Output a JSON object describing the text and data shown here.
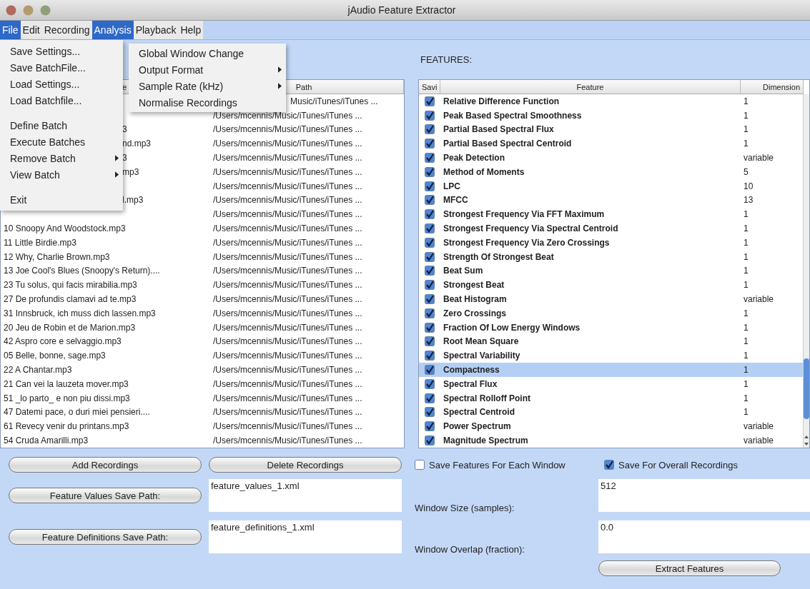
{
  "window": {
    "title": "jAudio Feature Extractor"
  },
  "menu_bar": [
    {
      "label": "File",
      "selected": true
    },
    {
      "label": "Edit",
      "selected": false
    },
    {
      "label": "Recording",
      "selected": false
    },
    {
      "label": "Analysis",
      "selected": true
    },
    {
      "label": "Playback",
      "selected": false
    },
    {
      "label": "Help",
      "selected": false
    }
  ],
  "file_menu": [
    {
      "kind": "item",
      "label": "Save Settings..."
    },
    {
      "kind": "item",
      "label": "Save BatchFile..."
    },
    {
      "kind": "item",
      "label": "Load Settings..."
    },
    {
      "kind": "item",
      "label": "Load Batchfile..."
    },
    {
      "kind": "separator"
    },
    {
      "kind": "item",
      "label": "Define Batch"
    },
    {
      "kind": "item",
      "label": "Execute Batches"
    },
    {
      "kind": "submenu",
      "label": "Remove Batch"
    },
    {
      "kind": "submenu",
      "label": "View Batch"
    },
    {
      "kind": "separator"
    },
    {
      "kind": "item",
      "label": "Exit"
    }
  ],
  "analysis_menu": [
    {
      "kind": "item",
      "label": "Global Window Change"
    },
    {
      "kind": "submenu",
      "label": "Output Format"
    },
    {
      "kind": "submenu",
      "label": "Sample Rate (kHz)"
    },
    {
      "kind": "item",
      "label": "Normalise Recordings"
    }
  ],
  "recordings_table": {
    "columns": [
      {
        "label": "e",
        "kind": "clipped"
      },
      {
        "label": "Path",
        "kind": "full"
      }
    ],
    "rows": [
      {
        "kind": "clipped",
        "path": "Music/iTunes/iTunes ..."
      },
      {
        "kind": "clipped",
        "path": "/Users/mcennis/Music/iTunes/iTunes ..."
      },
      {
        "kind": "clipped",
        "name": "3",
        "path": "/Users/mcennis/Music/iTunes/iTunes ..."
      },
      {
        "kind": "clipped",
        "name": "nd.mp3",
        "path": "/Users/mcennis/Music/iTunes/iTunes ..."
      },
      {
        "kind": "clipped",
        "name": "3",
        "path": "/Users/mcennis/Music/iTunes/iTunes ..."
      },
      {
        "kind": "clipped",
        "name": "mp3",
        "path": "/Users/mcennis/Music/iTunes/iTunes ..."
      },
      {
        "kind": "clipped",
        "path": "/Users/mcennis/Music/iTunes/iTunes ..."
      },
      {
        "kind": "clipped",
        "name": "l.mp3",
        "path": "/Users/mcennis/Music/iTunes/iTunes ..."
      },
      {
        "kind": "clipped",
        "path": "/Users/mcennis/Music/iTunes/iTunes ..."
      },
      {
        "kind": "full",
        "name": "10 Snoopy And Woodstock.mp3",
        "path": "/Users/mcennis/Music/iTunes/iTunes ..."
      },
      {
        "kind": "full",
        "name": "11 Little Birdie.mp3",
        "path": "/Users/mcennis/Music/iTunes/iTunes ..."
      },
      {
        "kind": "full",
        "name": "12 Why, Charlie Brown.mp3",
        "path": "/Users/mcennis/Music/iTunes/iTunes ..."
      },
      {
        "kind": "full",
        "name": "13 Joe Cool's Blues (Snoopy's Return)....",
        "path": "/Users/mcennis/Music/iTunes/iTunes ..."
      },
      {
        "kind": "full",
        "name": "23 Tu solus, qui facis mirabilia.mp3",
        "path": "/Users/mcennis/Music/iTunes/iTunes ..."
      },
      {
        "kind": "full",
        "name": "27 De profundis clamavi ad te.mp3",
        "path": "/Users/mcennis/Music/iTunes/iTunes ..."
      },
      {
        "kind": "full",
        "name": "31 Innsbruck, ich muss dich lassen.mp3",
        "path": "/Users/mcennis/Music/iTunes/iTunes ..."
      },
      {
        "kind": "full",
        "name": "20 Jeu de Robin et de Marion.mp3",
        "path": "/Users/mcennis/Music/iTunes/iTunes ..."
      },
      {
        "kind": "full",
        "name": "42 Aspro core e selvaggio.mp3",
        "path": "/Users/mcennis/Music/iTunes/iTunes ..."
      },
      {
        "kind": "full",
        "name": "05 Belle, bonne, sage.mp3",
        "path": "/Users/mcennis/Music/iTunes/iTunes ..."
      },
      {
        "kind": "full",
        "name": "22 A Chantar.mp3",
        "path": "/Users/mcennis/Music/iTunes/iTunes ..."
      },
      {
        "kind": "full",
        "name": "21 Can vei la lauzeta mover.mp3",
        "path": "/Users/mcennis/Music/iTunes/iTunes ..."
      },
      {
        "kind": "full",
        "name": "51 _lo parto_ e non piu dissi.mp3",
        "path": "/Users/mcennis/Music/iTunes/iTunes ..."
      },
      {
        "kind": "full",
        "name": "47 Datemi pace, o duri miei pensieri....",
        "path": "/Users/mcennis/Music/iTunes/iTunes ..."
      },
      {
        "kind": "full",
        "name": "61 Revecy venir du printans.mp3",
        "path": "/Users/mcennis/Music/iTunes/iTunes ..."
      },
      {
        "kind": "full",
        "name": "54 Cruda Amarilli.mp3",
        "path": "/Users/mcennis/Music/iTunes/iTunes ..."
      }
    ]
  },
  "features": {
    "label": "FEATURES:",
    "columns": [
      "Savi",
      "Feature",
      "Dimension"
    ],
    "rows": [
      {
        "checked": true,
        "selected": false,
        "name": "Relative Difference Function",
        "dimension": "1"
      },
      {
        "checked": true,
        "selected": false,
        "name": "Peak Based Spectral Smoothness",
        "dimension": "1"
      },
      {
        "checked": true,
        "selected": false,
        "name": "Partial Based Spectral Flux",
        "dimension": "1"
      },
      {
        "checked": true,
        "selected": false,
        "name": "Partial Based Spectral Centroid",
        "dimension": "1"
      },
      {
        "checked": true,
        "selected": false,
        "name": "Peak Detection",
        "dimension": "variable"
      },
      {
        "checked": true,
        "selected": false,
        "name": "Method of Moments",
        "dimension": "5"
      },
      {
        "checked": true,
        "selected": false,
        "name": "LPC",
        "dimension": "10"
      },
      {
        "checked": true,
        "selected": false,
        "name": "MFCC",
        "dimension": "13"
      },
      {
        "checked": true,
        "selected": false,
        "name": "Strongest Frequency Via FFT Maximum",
        "dimension": "1"
      },
      {
        "checked": true,
        "selected": false,
        "name": "Strongest Frequency Via Spectral Centroid",
        "dimension": "1"
      },
      {
        "checked": true,
        "selected": false,
        "name": "Strongest Frequency Via Zero Crossings",
        "dimension": "1"
      },
      {
        "checked": true,
        "selected": false,
        "name": "Strength Of Strongest Beat",
        "dimension": "1"
      },
      {
        "checked": true,
        "selected": false,
        "name": "Beat Sum",
        "dimension": "1"
      },
      {
        "checked": true,
        "selected": false,
        "name": "Strongest Beat",
        "dimension": "1"
      },
      {
        "checked": true,
        "selected": false,
        "name": "Beat Histogram",
        "dimension": "variable"
      },
      {
        "checked": true,
        "selected": false,
        "name": "Zero Crossings",
        "dimension": "1"
      },
      {
        "checked": true,
        "selected": false,
        "name": "Fraction Of Low Energy Windows",
        "dimension": "1"
      },
      {
        "checked": true,
        "selected": false,
        "name": "Root Mean Square",
        "dimension": "1"
      },
      {
        "checked": true,
        "selected": false,
        "name": "Spectral Variability",
        "dimension": "1"
      },
      {
        "checked": true,
        "selected": true,
        "name": "Compactness",
        "dimension": "1"
      },
      {
        "checked": true,
        "selected": false,
        "name": "Spectral Flux",
        "dimension": "1"
      },
      {
        "checked": true,
        "selected": false,
        "name": "Spectral Rolloff Point",
        "dimension": "1"
      },
      {
        "checked": true,
        "selected": false,
        "name": "Spectral Centroid",
        "dimension": "1"
      },
      {
        "checked": true,
        "selected": false,
        "name": "Power Spectrum",
        "dimension": "variable"
      },
      {
        "checked": true,
        "selected": false,
        "name": "Magnitude Spectrum",
        "dimension": "variable"
      }
    ]
  },
  "recording_buttons": [
    "Add Recordings",
    "Delete Recordings"
  ],
  "save_options": [
    {
      "label": "Save Features For Each Window",
      "checked": false
    },
    {
      "label": "Save For Overall Recordings",
      "checked": true
    }
  ],
  "save_paths": [
    {
      "button": "Feature Values Save Path:",
      "value": "feature_values_1.xml"
    },
    {
      "button": "Feature Definitions Save Path:",
      "value": "feature_definitions_1.xml"
    }
  ],
  "window_settings": [
    {
      "label": "Window Size (samples):",
      "value": "512"
    },
    {
      "label": "Window Overlap (fraction):",
      "value": "0.0"
    }
  ],
  "extract_button": "Extract Features"
}
